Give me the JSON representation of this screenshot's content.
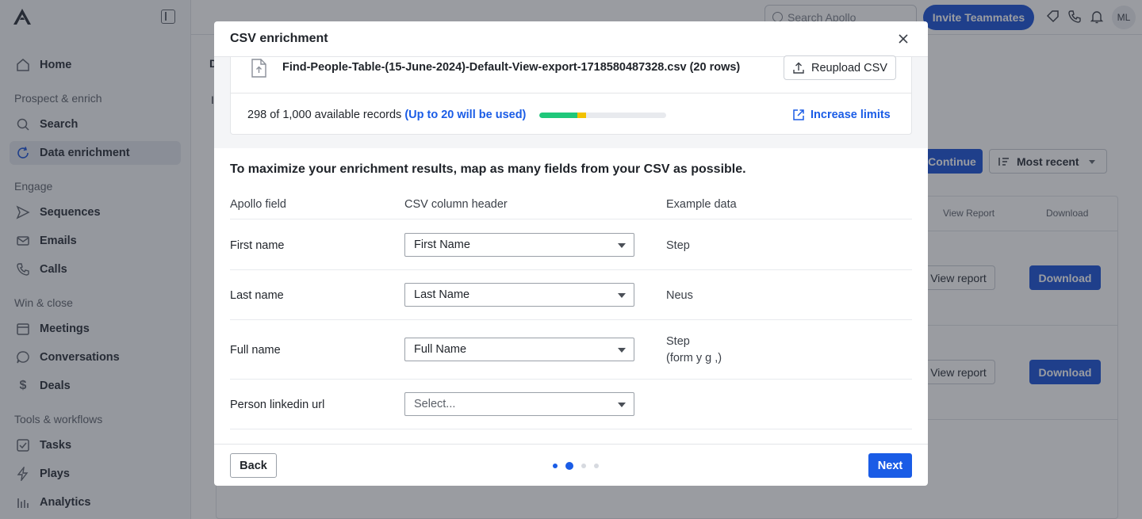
{
  "app": {
    "search_placeholder": "Search Apollo",
    "invite_label": "Invite Teammates",
    "avatar_initials": "ML"
  },
  "sidebar": {
    "home": "Home",
    "sections": [
      {
        "title": "Prospect & enrich",
        "items": [
          "Search",
          "Data enrichment"
        ]
      },
      {
        "title": "Engage",
        "items": [
          "Sequences",
          "Emails",
          "Calls"
        ]
      },
      {
        "title": "Win & close",
        "items": [
          "Meetings",
          "Conversations",
          "Deals"
        ]
      },
      {
        "title": "Tools & workflows",
        "items": [
          "Tasks",
          "Plays",
          "Analytics"
        ]
      }
    ],
    "active_item": "Data enrichment"
  },
  "background": {
    "continue_label": "Continue",
    "sort_label": "Most recent",
    "table_headers": [
      "View Report",
      "Download"
    ],
    "row_buttons": {
      "view": "View report",
      "download": "Download"
    },
    "partial_letters": [
      "D",
      "I"
    ]
  },
  "modal": {
    "title": "CSV enrichment",
    "file": {
      "name": "Find-People-Table-(15-June-2024)-Default-View-export-1718580487328.csv (20 rows)",
      "reupload_label": "Reupload CSV"
    },
    "records": {
      "text": "298 of 1,000 available records",
      "highlight": "(Up to 20 will be used)",
      "progress_used_fraction": 0.298,
      "progress_pending_fraction": 0.02,
      "increase_label": "Increase limits"
    },
    "mapping_title": "To maximize your enrichment results, map as many fields from your CSV as possible.",
    "columns": {
      "apollo": "Apollo field",
      "csv": "CSV column header",
      "example": "Example data"
    },
    "rows": [
      {
        "field": "First name",
        "selected": "First Name",
        "example_line1": "Step",
        "example_line2": ""
      },
      {
        "field": "Last name",
        "selected": "Last Name",
        "example_line1": "Neus",
        "example_line2": ""
      },
      {
        "field": "Full name",
        "selected": "Full Name",
        "example_line1": "Step",
        "example_line2": "(form       y      g   ,)"
      },
      {
        "field": "Person linkedin url",
        "selected": "Select...",
        "example_line1": "",
        "example_line2": ""
      }
    ],
    "footer": {
      "back_label": "Back",
      "next_label": "Next",
      "steps": {
        "total": 4,
        "current": 2
      }
    },
    "colors": {
      "primary": "#1a5ce6",
      "progress_green": "#1fc77a",
      "progress_yellow": "#f2c200"
    }
  }
}
